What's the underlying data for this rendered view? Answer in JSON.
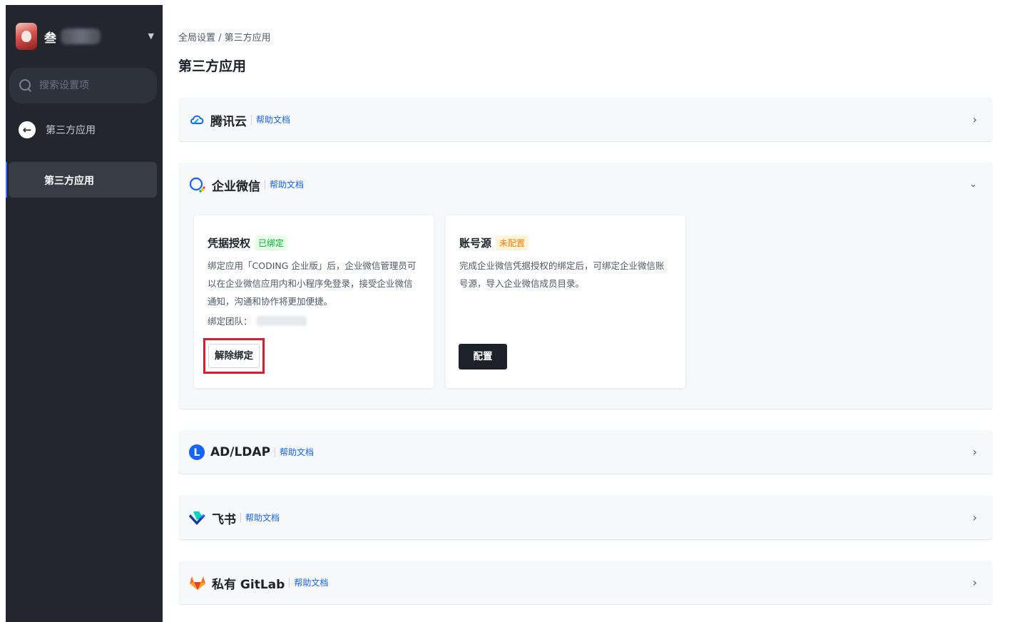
{
  "sidebar": {
    "org_name": "叁",
    "search_placeholder": "搜索设置项",
    "back_label": "第三方应用",
    "nav_items": [
      {
        "label": "第三方应用",
        "active": true
      }
    ]
  },
  "header": {
    "breadcrumb": "全局设置 / 第三方应用",
    "title": "第三方应用"
  },
  "providers": [
    {
      "name": "腾讯云",
      "doc_link": "帮助文档",
      "icon": "tencent-cloud-icon",
      "expanded": false
    },
    {
      "name": "企业微信",
      "doc_link": "帮助文档",
      "icon": "wecom-icon",
      "expanded": true
    },
    {
      "name": "AD/LDAP",
      "doc_link": "帮助文档",
      "icon": "ldap-icon",
      "expanded": false
    },
    {
      "name": "飞书",
      "doc_link": "帮助文档",
      "icon": "feishu-icon",
      "expanded": false
    },
    {
      "name": "私有 GitLab",
      "doc_link": "帮助文档",
      "icon": "gitlab-icon",
      "expanded": false
    }
  ],
  "wecom_cards": {
    "credential": {
      "title": "凭据授权",
      "badge": "已绑定",
      "description": "绑定应用「CODING 企业版」后，企业微信管理员可以在企业微信应用内和小程序免登录，接受企业微信通知，沟通和协作将更加便捷。",
      "team_label": "绑定团队：",
      "button": "解除绑定"
    },
    "account_source": {
      "title": "账号源",
      "badge": "未配置",
      "description": "完成企业微信凭据授权的绑定后，可绑定企业微信账号源，导入企业微信成员目录。",
      "button": "配置"
    }
  },
  "colors": {
    "sidebar_bg": "#23262d",
    "link": "#1664ff",
    "bound_badge": "#00b42a",
    "unconfigured_badge": "#ff7d00",
    "highlight_box": "#d81e2c",
    "primary_button": "#1d2129"
  }
}
